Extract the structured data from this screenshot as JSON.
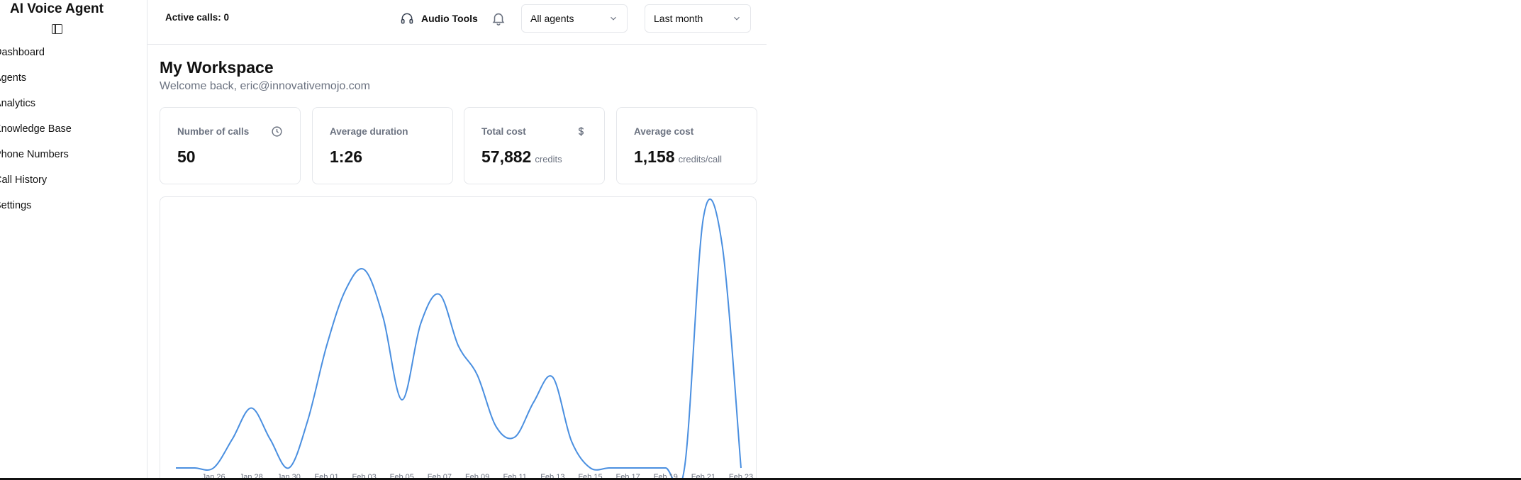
{
  "sidebar": {
    "brand": "AI Voice Agent",
    "items": [
      {
        "label": "Dashboard"
      },
      {
        "label": "Agents"
      },
      {
        "label": "Analytics"
      },
      {
        "label": "Knowledge Base"
      },
      {
        "label": "Phone Numbers"
      },
      {
        "label": "Call History"
      },
      {
        "label": "Settings"
      }
    ]
  },
  "header": {
    "active_calls": "Active calls: 0",
    "audio_tools": "Audio Tools",
    "agent_filter": "All agents",
    "range_filter": "Last month"
  },
  "main": {
    "title": "My Workspace",
    "welcome": "Welcome back, eric@innovativemojo.com"
  },
  "cards": [
    {
      "label": "Number of calls",
      "value": "50",
      "unit": "",
      "icon": "clock-icon"
    },
    {
      "label": "Average duration",
      "value": "1:26",
      "unit": "",
      "icon": ""
    },
    {
      "label": "Total cost",
      "value": "57,882",
      "unit": "credits",
      "icon": "dollar-icon"
    },
    {
      "label": "Average cost",
      "value": "1,158",
      "unit": "credits/call",
      "icon": ""
    }
  ],
  "colors": {
    "line": "#4a8fe0",
    "border": "#e5e7eb",
    "muted": "#6b7280"
  },
  "chart_data": {
    "type": "line",
    "title": "",
    "xlabel": "",
    "ylabel": "",
    "x_tick_labels": [
      "Jan 26",
      "Jan 28",
      "Jan 30",
      "Feb 01",
      "Feb 03",
      "Feb 05",
      "Feb 07",
      "Feb 09",
      "Feb 11",
      "Feb 13",
      "Feb 15",
      "Feb 17",
      "Feb 19",
      "Feb 21",
      "Feb 23"
    ],
    "x": [
      "Jan 24",
      "Jan 25",
      "Jan 26",
      "Jan 27",
      "Jan 28",
      "Jan 29",
      "Jan 30",
      "Jan 31",
      "Feb 01",
      "Feb 02",
      "Feb 03",
      "Feb 04",
      "Feb 05",
      "Feb 06",
      "Feb 07",
      "Feb 08",
      "Feb 09",
      "Feb 10",
      "Feb 11",
      "Feb 12",
      "Feb 13",
      "Feb 14",
      "Feb 15",
      "Feb 16",
      "Feb 17",
      "Feb 18",
      "Feb 19",
      "Feb 20",
      "Feb 21",
      "Feb 22",
      "Feb 23"
    ],
    "series": [
      {
        "values": [
          0,
          0,
          0,
          1.4,
          2.9,
          1.4,
          0,
          2.3,
          5.9,
          8.6,
          9.6,
          7.3,
          3.3,
          7.0,
          8.4,
          5.9,
          4.5,
          2.0,
          1.5,
          3.2,
          4.4,
          1.3,
          0,
          0,
          0,
          0,
          0,
          0,
          12.1,
          10.8,
          0
        ]
      }
    ],
    "ylim": [
      0,
      12.7
    ],
    "grid": false,
    "legend": "none"
  }
}
